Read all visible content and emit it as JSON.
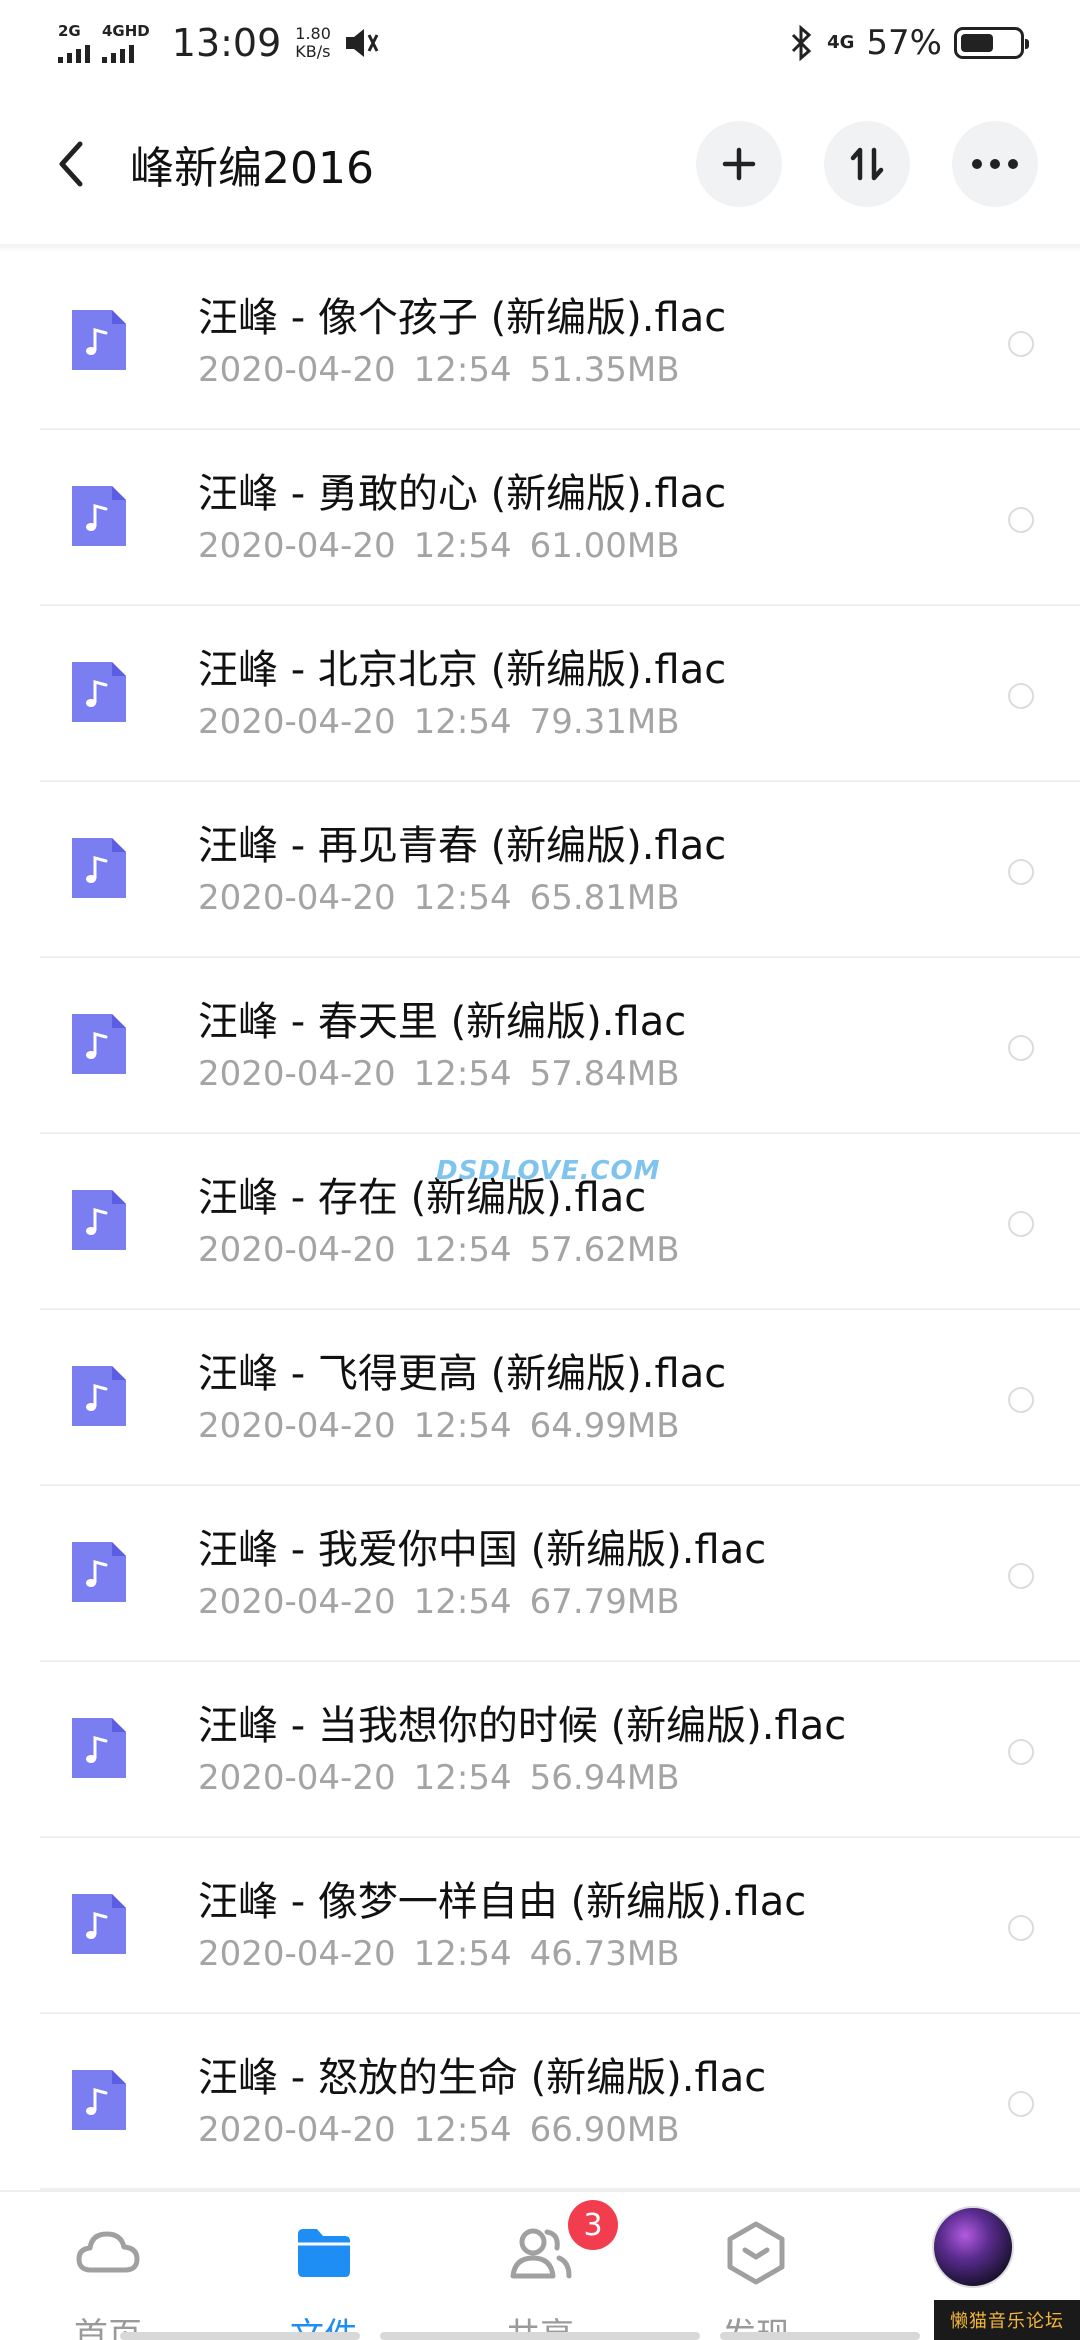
{
  "status_bar": {
    "sim1": "2G",
    "sim2": "4GHD",
    "time": "13:09",
    "speed_value": "1.80",
    "speed_unit": "KB/s",
    "network": "4G",
    "battery_percent": "57%",
    "battery_level": 0.57
  },
  "header": {
    "title": "峰新编2016",
    "actions": [
      "add-icon",
      "sort-icon",
      "more-icon"
    ]
  },
  "files": [
    {
      "name": "汪峰 - 像个孩子 (新编版).flac",
      "date": "2020-04-20",
      "time": "12:54",
      "size": "51.35MB"
    },
    {
      "name": "汪峰 - 勇敢的心 (新编版).flac",
      "date": "2020-04-20",
      "time": "12:54",
      "size": "61.00MB"
    },
    {
      "name": "汪峰 - 北京北京 (新编版).flac",
      "date": "2020-04-20",
      "time": "12:54",
      "size": "79.31MB"
    },
    {
      "name": "汪峰 - 再见青春 (新编版).flac",
      "date": "2020-04-20",
      "time": "12:54",
      "size": "65.81MB"
    },
    {
      "name": "汪峰 - 春天里 (新编版).flac",
      "date": "2020-04-20",
      "time": "12:54",
      "size": "57.84MB"
    },
    {
      "name": "汪峰 - 存在 (新编版).flac",
      "date": "2020-04-20",
      "time": "12:54",
      "size": "57.62MB"
    },
    {
      "name": "汪峰 - 飞得更高 (新编版).flac",
      "date": "2020-04-20",
      "time": "12:54",
      "size": "64.99MB"
    },
    {
      "name": "汪峰 - 我爱你中国 (新编版).flac",
      "date": "2020-04-20",
      "time": "12:54",
      "size": "67.79MB"
    },
    {
      "name": "汪峰 - 当我想你的时候 (新编版).flac",
      "date": "2020-04-20",
      "time": "12:54",
      "size": "56.94MB"
    },
    {
      "name": "汪峰 - 像梦一样自由 (新编版).flac",
      "date": "2020-04-20",
      "time": "12:54",
      "size": "46.73MB"
    },
    {
      "name": "汪峰 - 怒放的生命 (新编版).flac",
      "date": "2020-04-20",
      "time": "12:54",
      "size": "66.90MB"
    }
  ],
  "watermark": "DSDLOVE.COM",
  "nav": {
    "items": [
      {
        "label": "首页",
        "icon": "cloud-icon"
      },
      {
        "label": "文件",
        "icon": "folder-icon"
      },
      {
        "label": "共享",
        "icon": "people-icon"
      },
      {
        "label": "发现",
        "icon": "discover-icon"
      }
    ],
    "share_badge": "3"
  },
  "forum_tag": "懒猫音乐论坛",
  "colors": {
    "accent": "#1e8ef5",
    "file_icon": "#7b7ef0",
    "badge": "#f23d4f"
  }
}
